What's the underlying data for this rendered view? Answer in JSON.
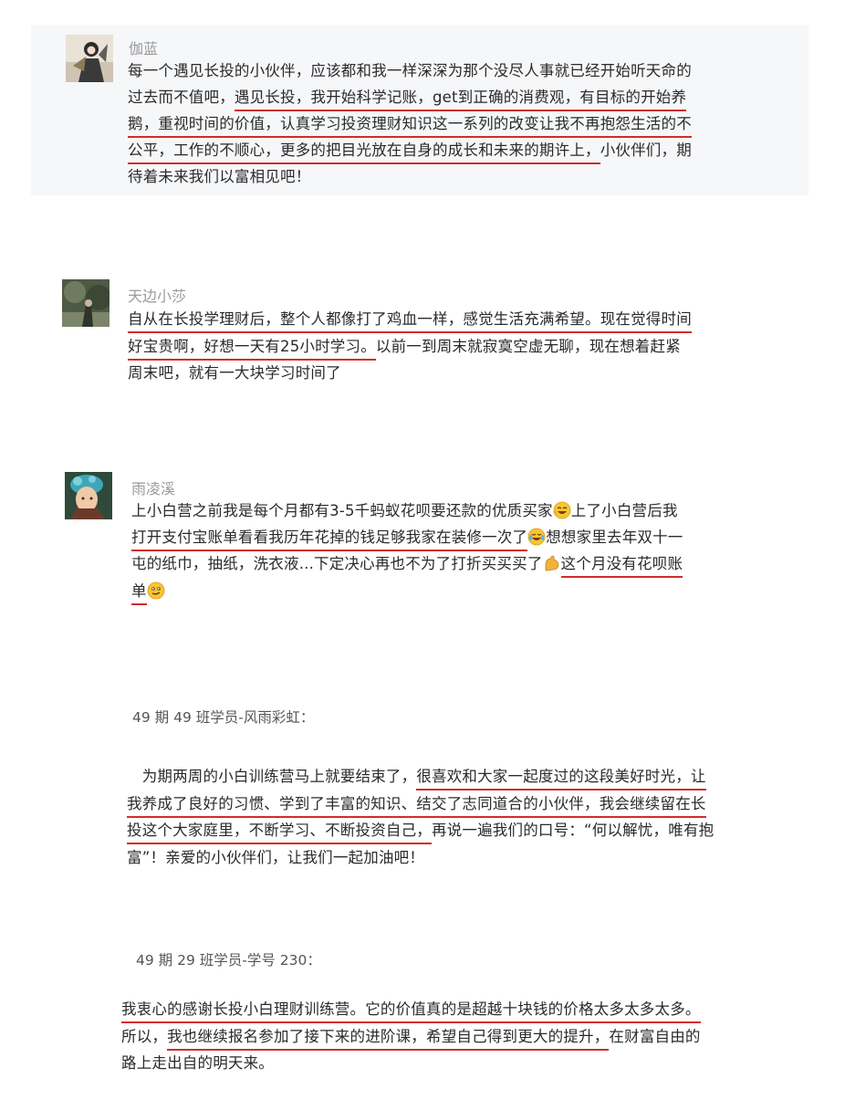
{
  "comments": [
    {
      "name": "伽蓝",
      "lines": [
        [
          "每一个遇见长投的小伙伴，应该都和我一样深深为那个没尽人事就已经开始听天命的"
        ],
        [
          "过去而不值吧，",
          {
            "u": "遇见长投，我开始科学记账，get到正确的消费观，有目标的开始养"
          }
        ],
        [
          {
            "u": "鹅，重视时间的价值，认真学习投资理财知识这一系列的改变让我不再抱怨生活的不"
          }
        ],
        [
          {
            "u": "公平，工作的不顺心，更多的把目光放在自身的成长和未来的期许上，"
          },
          "小伙伴们，期"
        ],
        [
          "待着未来我们以富相见吧！"
        ]
      ]
    },
    {
      "name": "天边小莎",
      "lines": [
        [
          {
            "u": "自从在长投学理财后，整个人都像打了鸡血一样，感觉生活充满希望。"
          },
          {
            "u": "现在觉得时间"
          }
        ],
        [
          {
            "u": "好宝贵啊，好想一天有25小时学习。"
          },
          "以前一到周末就寂寞空虚无聊，现在想着赶紧"
        ],
        [
          "周末吧，就有一大块学习时间了"
        ]
      ]
    },
    {
      "name": "雨凌溪",
      "lines": [
        [
          "上小白营之前我是每个月都有3-5千蚂蚁花呗要还款的优质买家",
          {
            "emoji": "cry-laugh-emoji"
          },
          "上了小白营后我"
        ],
        [
          {
            "u": "打开支付宝账单看看我历年花掉的钱足够我家在装修一次了"
          },
          {
            "emoji": "tears-of-joy-emoji"
          },
          "想想家里去年双十一"
        ],
        [
          "屯的纸巾，抽纸，洗衣液...下定决心再也不为了打折买买买了",
          {
            "emoji": "flexed-biceps-emoji"
          },
          {
            "u": "这个月没有花呗账"
          }
        ],
        [
          {
            "u": "单"
          },
          {
            "emoji": "smirk-emoji"
          }
        ]
      ]
    }
  ],
  "posts": [
    {
      "caption": "49 期 49 班学员-风雨彩虹：",
      "lines": [
        [
          "　为期两周的小白训练营马上就要结束了，",
          {
            "u": "很喜欢和大家一起度过的这段美好时光，让"
          }
        ],
        [
          {
            "u": "我养成了良好的习惯、学到了丰富的知识、结交了志同道合的小伙伴，我会继续留在长"
          }
        ],
        [
          {
            "u": "投这个大家庭里，不断学习、不断投资自己，"
          },
          "再说一遍我们的口号：“何以解忧，唯有抱"
        ],
        [
          "富”！亲爱的小伙伴们，让我们一起加油吧！"
        ]
      ]
    },
    {
      "caption": "49 期 29 班学员-学号 230：",
      "lines": [
        [
          {
            "u": "我衷心的感谢长投小白理财训练营。它的价值真的是超越十块钱的价格太多太多太多。"
          }
        ],
        [
          "所以，",
          {
            "u": "我也继续报名参加了接下来的进阶课，希望自己得到更大的提升，"
          },
          "在财富自由的"
        ],
        [
          "路上走出自的明天来。"
        ]
      ]
    }
  ],
  "colors": {
    "underline": "#d22c2c",
    "name": "#9a9a9a",
    "card_bg": "#f6f7f9"
  }
}
